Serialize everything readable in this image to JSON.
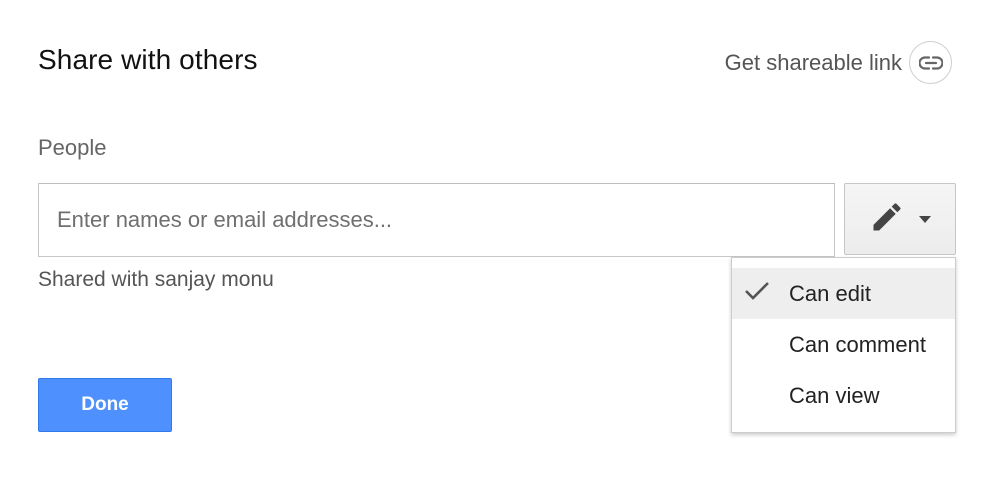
{
  "dialog": {
    "title": "Share with others",
    "share_link_label": "Get shareable link"
  },
  "people": {
    "label": "People",
    "input_placeholder": "Enter names or email addresses...",
    "input_value": "",
    "permission_icon": "pencil-icon",
    "shared_with": "Shared with sanjay monu"
  },
  "actions": {
    "done_label": "Done"
  },
  "permission_menu": {
    "selected": "Can edit",
    "items": [
      {
        "label": "Can edit",
        "checked": true
      },
      {
        "label": "Can comment",
        "checked": false
      },
      {
        "label": "Can view",
        "checked": false
      }
    ]
  },
  "colors": {
    "primary_button": "#4d90fe",
    "selected_item_bg": "#eeeeee"
  }
}
